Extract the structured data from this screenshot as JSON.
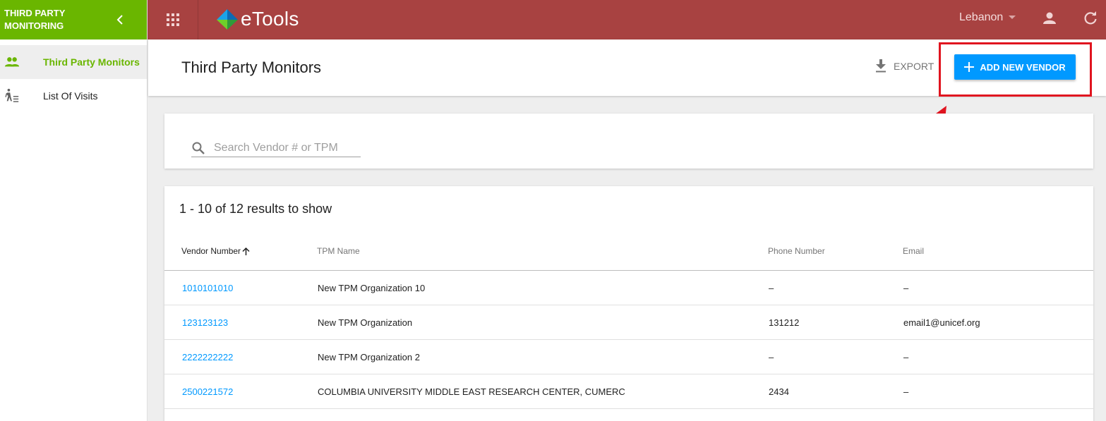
{
  "sidebar": {
    "title": "THIRD PARTY MONITORING",
    "items": [
      {
        "label": "Third Party Monitors",
        "icon": "people-icon",
        "active": true
      },
      {
        "label": "List Of Visits",
        "icon": "walking-list-icon",
        "active": false
      }
    ]
  },
  "topbar": {
    "app_name": "eTools",
    "country": "Lebanon"
  },
  "header": {
    "title": "Third Party Monitors",
    "export_label": "EXPORT",
    "add_label": "ADD NEW VENDOR"
  },
  "search": {
    "placeholder": "Search Vendor # or TPM",
    "value": ""
  },
  "results": {
    "summary": "1 - 10 of 12 results to show",
    "columns": [
      "Vendor Number",
      "TPM Name",
      "Phone Number",
      "Email"
    ],
    "rows": [
      {
        "vendor": "1010101010",
        "name": "New TPM Organization 10",
        "phone": "–",
        "email": "–"
      },
      {
        "vendor": "123123123",
        "name": "New TPM Organization",
        "phone": "131212",
        "email": "email1@unicef.org"
      },
      {
        "vendor": "2222222222",
        "name": "New TPM Organization 2",
        "phone": "–",
        "email": "–"
      },
      {
        "vendor": "2500221572",
        "name": "COLUMBIA UNIVERSITY MIDDLE EAST RESEARCH CENTER, CUMERC",
        "phone": "2434",
        "email": "–"
      }
    ]
  },
  "colors": {
    "sidebar_header": "#6ab600",
    "topbar": "#a84241",
    "primary_button": "#0099ff",
    "link": "#0099ff",
    "annotation": "#e0141f"
  }
}
